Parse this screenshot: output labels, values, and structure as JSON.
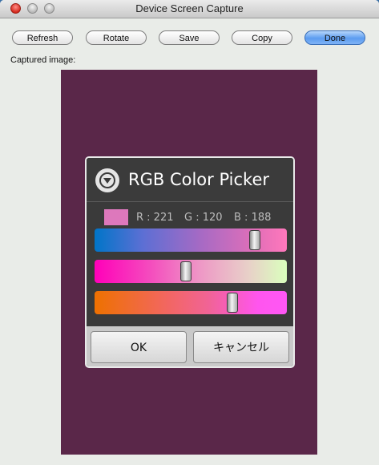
{
  "window": {
    "title": "Device Screen Capture"
  },
  "toolbar": {
    "buttons": [
      {
        "label": "Refresh"
      },
      {
        "label": "Rotate"
      },
      {
        "label": "Save"
      },
      {
        "label": "Copy"
      },
      {
        "label": "Done"
      }
    ]
  },
  "caption": "Captured image:",
  "device": {
    "background_color": "#5a2749",
    "dialog": {
      "title": "RGB Color Picker",
      "icon": "chevron-down-circle-icon",
      "swatch_color": "#dd78bc",
      "r_label": "R : 221",
      "g_label": "G : 120",
      "b_label": "B : 188",
      "sliders": [
        {
          "channel": "R",
          "value": 221,
          "max": 255
        },
        {
          "channel": "G",
          "value": 120,
          "max": 255
        },
        {
          "channel": "B",
          "value": 188,
          "max": 255
        }
      ],
      "ok_label": "OK",
      "cancel_label": "キャンセル"
    }
  },
  "colors": {
    "done_button": "#5b9cf0",
    "close_light": "#d52a1e"
  }
}
